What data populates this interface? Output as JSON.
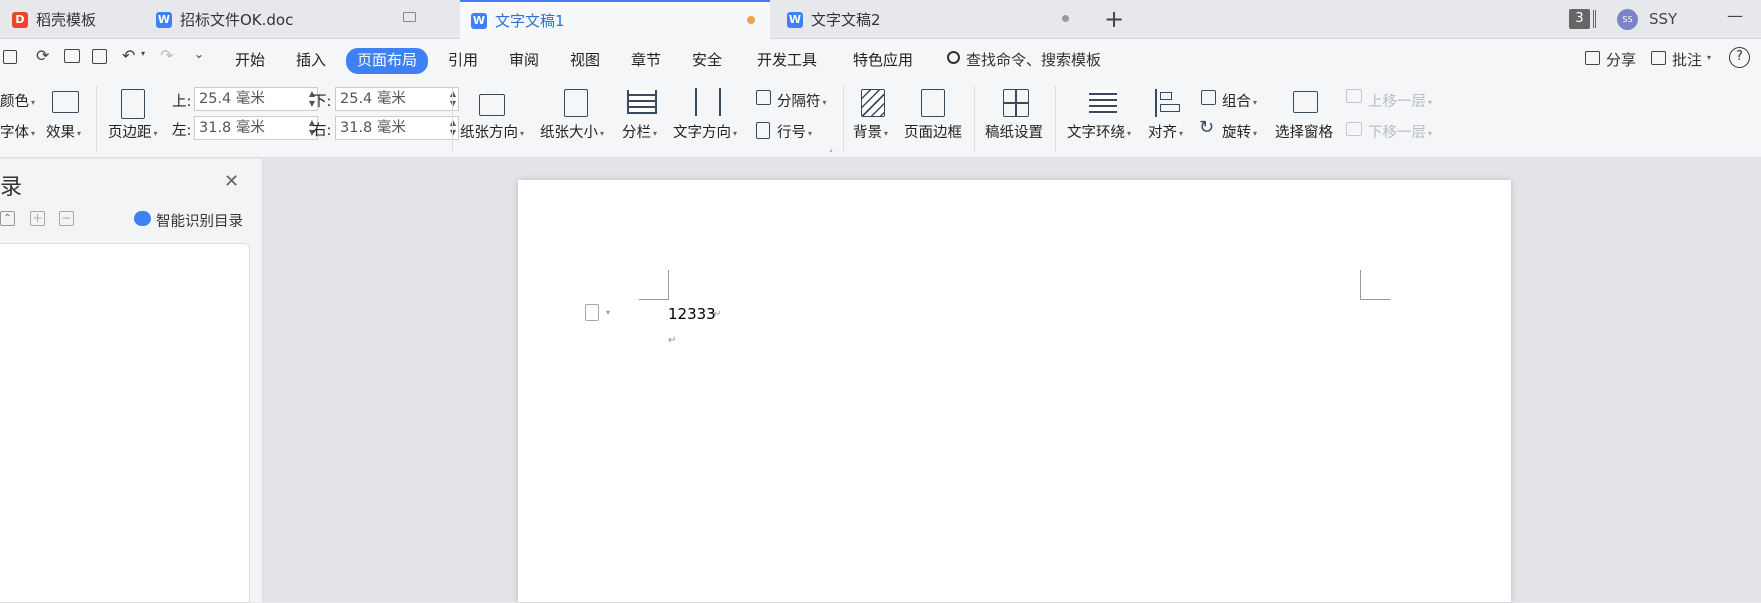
{
  "tabs": [
    {
      "label": "稻壳模板",
      "logo": "D"
    },
    {
      "label": "招标文件OK.doc",
      "logo": "W"
    },
    {
      "label": "文字文稿1",
      "logo": "W"
    },
    {
      "label": "文字文稿2",
      "logo": "W"
    }
  ],
  "window": {
    "count_badge": "3",
    "user_initials": "SS",
    "user_name": "SSY",
    "minimize": "—"
  },
  "ribbon_tabs": [
    "开始",
    "插入",
    "页面布局",
    "引用",
    "审阅",
    "视图",
    "章节",
    "安全",
    "开发工具",
    "特色应用"
  ],
  "search": {
    "placeholder": "查找命令、搜索模板"
  },
  "right_actions": {
    "share": "分享",
    "comment": "批注",
    "help": "?"
  },
  "toolbar": {
    "color": "颜色",
    "font": "字体",
    "effect": "效果",
    "margins": "页边距",
    "top_label": "上:",
    "top_value": "25.4 毫米",
    "bottom_label": "下:",
    "bottom_value": "25.4 毫米",
    "left_label": "左:",
    "left_value": "31.8 毫米",
    "right_label": "右:",
    "right_value": "31.8 毫米",
    "orientation": "纸张方向",
    "paper_size": "纸张大小",
    "columns": "分栏",
    "text_direction": "文字方向",
    "breaks": "分隔符",
    "line_numbers": "行号",
    "background": "背景",
    "page_border": "页面边框",
    "manuscript": "稿纸设置",
    "text_wrap": "文字环绕",
    "align": "对齐",
    "group": "组合",
    "rotate": "旋转",
    "selection_pane": "选择窗格",
    "bring_forward": "上移一层",
    "send_backward": "下移一层"
  },
  "sidebar": {
    "title": "录",
    "smart_toc": "智能识别目录"
  },
  "document": {
    "line1": "12333",
    "para_mark": "↵"
  },
  "colors": {
    "accent": "#3e80f6",
    "wps_red": "#e8472a"
  }
}
